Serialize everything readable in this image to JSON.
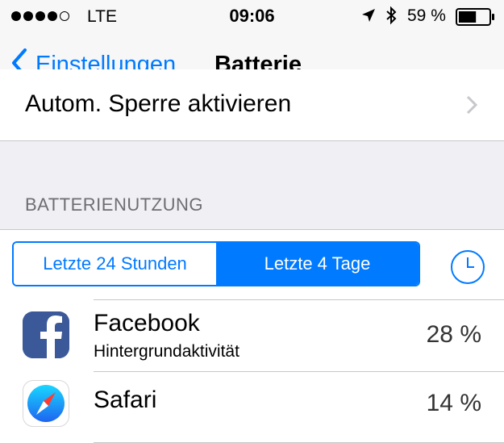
{
  "status_bar": {
    "carrier": "LTE",
    "time": "09:06",
    "battery_percent": "59 %",
    "battery_level": 0.59
  },
  "nav": {
    "back_label": "Einstellungen",
    "title": "Batterie"
  },
  "partial_row": {
    "label": "Autom. Sperre aktivieren"
  },
  "section": {
    "header": "BATTERIENUTZUNG"
  },
  "segments": [
    {
      "label": "Letzte 24 Stunden",
      "selected": false
    },
    {
      "label": "Letzte 4 Tage",
      "selected": true
    }
  ],
  "apps": [
    {
      "name": "Facebook",
      "subtitle": "Hintergrundaktivität",
      "percent": "28 %",
      "icon": "facebook-icon"
    },
    {
      "name": "Safari",
      "subtitle": "",
      "percent": "14 %",
      "icon": "safari-icon"
    }
  ],
  "colors": {
    "accent": "#007aff",
    "facebook": "#3b5998"
  }
}
